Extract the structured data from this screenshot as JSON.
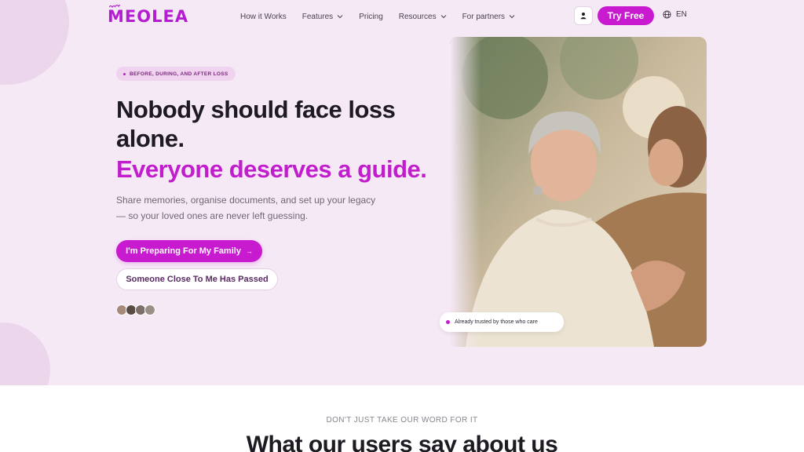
{
  "brand": {
    "name": "MEOLEA",
    "color": "#c81bd0"
  },
  "nav": {
    "items": [
      {
        "label": "How it Works",
        "dropdown": false
      },
      {
        "label": "Features",
        "dropdown": true
      },
      {
        "label": "Pricing",
        "dropdown": false
      },
      {
        "label": "Resources",
        "dropdown": true
      },
      {
        "label": "For partners",
        "dropdown": true
      }
    ],
    "user_icon": "user-icon",
    "cta_label": "Try Free",
    "language": "EN",
    "language_icon": "globe-icon"
  },
  "hero": {
    "eyebrow": "BEFORE, DURING, AND AFTER LOSS",
    "headline": "Nobody should face loss alone.",
    "headline_accent": "Everyone deserves a guide.",
    "subtext": "Share memories, organise documents, and set up your legacy — so your loved ones are never left guessing.",
    "primary_button": "I'm Preparing For My Family",
    "primary_button_icon": "arrow-right-icon",
    "secondary_button": "Someone Close To Me Has Passed",
    "avatar_count": 4,
    "trust_badge": "Already trusted by those who care",
    "background": "#f6e9f6"
  },
  "testimonials": {
    "eyebrow": "DON'T JUST TAKE OUR WORD FOR IT",
    "title": "What our users say about us"
  }
}
